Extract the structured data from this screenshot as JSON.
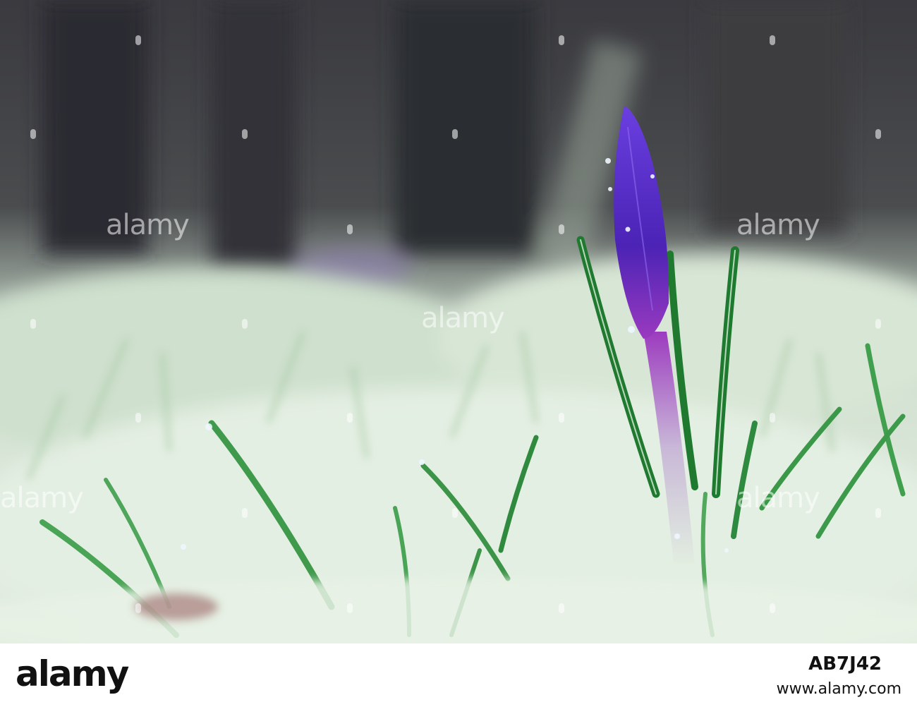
{
  "watermark": {
    "text": "alamy"
  },
  "footer": {
    "brand": "alamy",
    "image_id": "AB7J42",
    "url": "www.alamy.com"
  },
  "colors": {
    "crocus_bud": "#5b2fc9",
    "crocus_base": "#8a34b8",
    "grass_blade": "#2e8a3e",
    "frost": "#dfeee0",
    "background_dark": "#3a3a3e"
  }
}
